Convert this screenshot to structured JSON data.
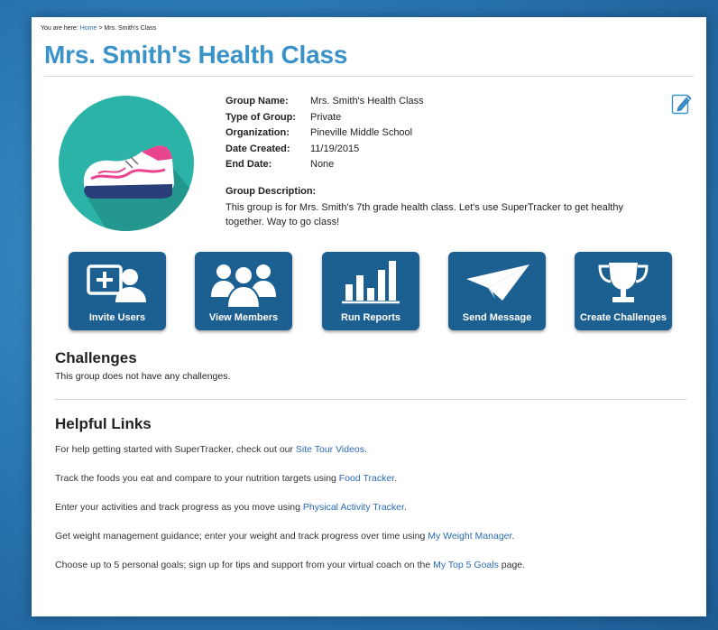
{
  "breadcrumb": {
    "prefix": "You are here:",
    "home": "Home",
    "separator": ">",
    "current": "Mrs. Smith's Class"
  },
  "page_title": "Mrs. Smith's Health Class",
  "group_icon": "sneaker-icon",
  "group_info": [
    {
      "label": "Group Name:",
      "value": "Mrs. Smith's Health Class"
    },
    {
      "label": "Type of Group:",
      "value": "Private"
    },
    {
      "label": "Organization:",
      "value": "Pineville Middle School"
    },
    {
      "label": "Date Created:",
      "value": "11/19/2015"
    },
    {
      "label": "End Date:",
      "value": "None"
    }
  ],
  "description": {
    "label": "Group Description:",
    "text": "This group is for Mrs. Smith's 7th grade health class. Let's use SuperTracker to get healthy together. Way to go class!"
  },
  "edit_icon": "pencil-edit-icon",
  "actions": [
    {
      "label": "Invite Users",
      "icon": "add-user-icon"
    },
    {
      "label": "View Members",
      "icon": "group-icon"
    },
    {
      "label": "Run Reports",
      "icon": "bar-chart-icon"
    },
    {
      "label": "Send Message",
      "icon": "paper-plane-icon"
    },
    {
      "label": "Create Challenges",
      "icon": "trophy-icon"
    }
  ],
  "challenges": {
    "title": "Challenges",
    "text": "This group does not have any challenges."
  },
  "helpful_links": {
    "title": "Helpful Links",
    "items": [
      {
        "before": "For help getting started with SuperTracker, check out our ",
        "link": "Site Tour Videos",
        "after": "."
      },
      {
        "before": "Track the foods you eat and compare to your nutrition targets using ",
        "link": "Food Tracker",
        "after": "."
      },
      {
        "before": "Enter your activities and track progress as you move using ",
        "link": "Physical Activity Tracker",
        "after": "."
      },
      {
        "before": "Get weight management guidance; enter your weight and track progress over time using ",
        "link": "My Weight Manager",
        "after": "."
      },
      {
        "before": "Choose up to 5 personal goals; sign up for tips and support from your virtual coach on the ",
        "link": "My Top 5 Goals",
        "after": " page."
      }
    ]
  },
  "colors": {
    "title": "#3993c9",
    "tile": "#1c5f91",
    "link": "#2a6bb3",
    "icon_circle": "#2bb3a8",
    "shoe_accent": "#e8448f"
  }
}
